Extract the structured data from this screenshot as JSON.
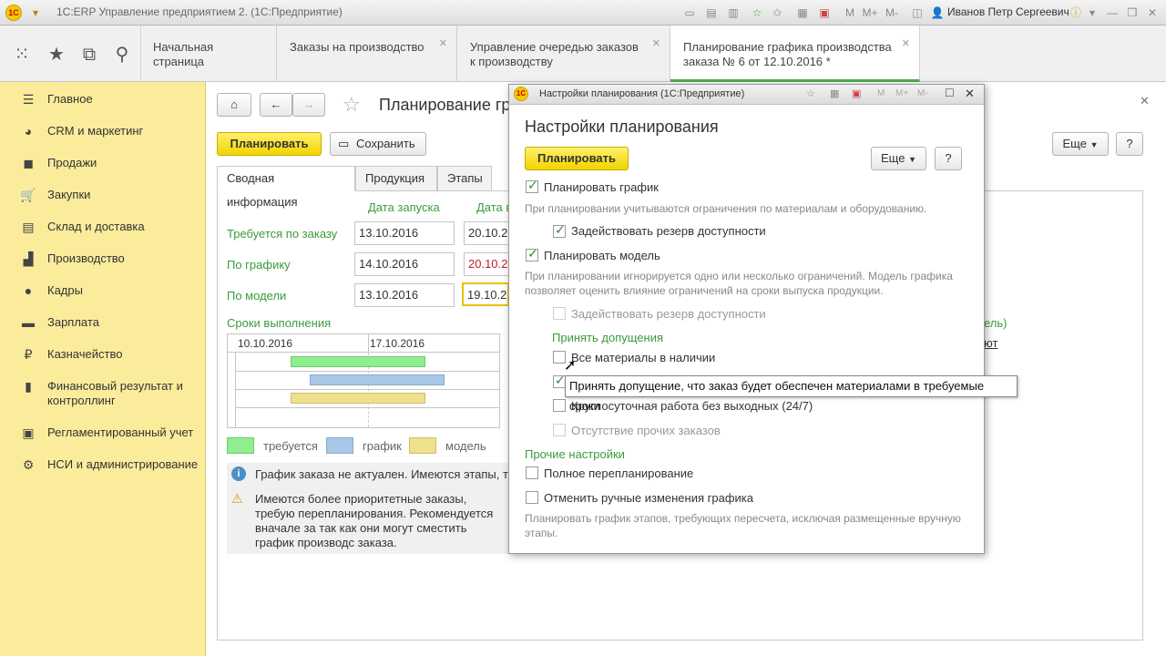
{
  "window": {
    "title": "1С:ERP Управление предприятием 2. (1С:Предприятие)",
    "user": "Иванов Петр Сергеевич",
    "logo_text": "1С"
  },
  "topbar": {
    "tabs": [
      {
        "label": "Начальная страница",
        "closable": false
      },
      {
        "label": "Заказы на производство",
        "closable": true
      },
      {
        "label": "Управление очередью заказов к производству",
        "closable": true
      },
      {
        "label": "Планирование графика производства заказа № 6 от 12.10.2016 *",
        "closable": true,
        "active": true
      }
    ]
  },
  "sidebar": {
    "items": [
      {
        "label": "Главное",
        "icon": "menu-icon"
      },
      {
        "label": "CRM и маркетинг",
        "icon": "pie-chart-icon"
      },
      {
        "label": "Продажи",
        "icon": "bag-icon"
      },
      {
        "label": "Закупки",
        "icon": "cart-icon"
      },
      {
        "label": "Склад и доставка",
        "icon": "warehouse-icon"
      },
      {
        "label": "Производство",
        "icon": "factory-icon"
      },
      {
        "label": "Кадры",
        "icon": "person-icon"
      },
      {
        "label": "Зарплата",
        "icon": "list-icon"
      },
      {
        "label": "Казначейство",
        "icon": "ruble-icon"
      },
      {
        "label": "Финансовый результат и контроллинг",
        "icon": "bar-chart-icon"
      },
      {
        "label": "Регламентированный учет",
        "icon": "document-icon"
      },
      {
        "label": "НСИ и администрирование",
        "icon": "gear-icon"
      }
    ]
  },
  "main": {
    "title": "Планирование гр",
    "plan_button": "Планировать",
    "save_button": "Сохранить",
    "more_button": "Еще",
    "help_button": "?",
    "tabs": [
      "Сводная информация",
      "Продукция",
      "Этапы"
    ],
    "col_start": "Дата запуска",
    "col_release": "Дата в",
    "rows": [
      {
        "label": "Требуется по заказу",
        "start": "13.10.2016",
        "release": "20.10.20"
      },
      {
        "label": "По графику",
        "start": "14.10.2016",
        "release": "20.10.20"
      },
      {
        "label": "По модели",
        "start": "13.10.2016",
        "release": "19.10.20"
      }
    ],
    "gantt_title": "Сроки выполнения",
    "gantt_dates": [
      "10.10.2016",
      "17.10.2016"
    ],
    "legend": [
      {
        "label": "требуется",
        "color": "#90ee90"
      },
      {
        "label": "график",
        "color": "#a8c8e8"
      },
      {
        "label": "модель",
        "color": "#eee08c"
      }
    ],
    "info_message": "График заказа не актуален. Имеются этапы, тр",
    "warning_message": "Имеются более приоритетные заказы, требую перепланирования. Рекомендуется вначале за так как они могут сместить график производс заказа.",
    "right_fragment_1": "ель)",
    "right_fragment_2": "ют"
  },
  "dialog": {
    "window_title": "Настройки планирования (1С:Предприятие)",
    "heading": "Настройки планирования",
    "plan_button": "Планировать",
    "more_button": "Еще",
    "help_button": "?",
    "plan_schedule": {
      "label": "Планировать график",
      "checked": true
    },
    "plan_schedule_hint": "При планировании учитываются ограничения по материалам и оборудованию.",
    "use_reserve_1": {
      "label": "Задействовать резерв доступности",
      "checked": true
    },
    "plan_model": {
      "label": "Планировать модель",
      "checked": true
    },
    "plan_model_hint": "При планировании игнорируется одно или несколько ограничений. Модель графика позволяет оценить влияние ограничений на сроки выпуска продукции.",
    "use_reserve_2": {
      "label": "Задействовать резерв доступности",
      "checked": false
    },
    "assumptions_title": "Принять допущения",
    "all_materials": {
      "label": "Все материалы в наличии",
      "checked": false
    },
    "materials_assumption_checked": true,
    "round_clock": {
      "label": "Круглосуточная работа без выходных (24/7)",
      "checked": false
    },
    "no_other_orders": {
      "label": "Отсутствие прочих заказов",
      "checked": false
    },
    "other_settings_title": "Прочие настройки",
    "full_replan": {
      "label": "Полное перепланирование",
      "checked": false
    },
    "cancel_manual": {
      "label": "Отменить ручные изменения графика",
      "checked": false
    },
    "bottom_hint": "Планировать график этапов, требующих пересчета, исключая размещенные вручную этапы."
  },
  "tooltip": {
    "text": "Принять допущение, что заказ будет обеспечен материалами в требуемые сроки"
  },
  "colors": {
    "accent_green": "#3c9a3c",
    "sidebar_bg": "#fbec9c",
    "button_yellow": "#f2d400"
  }
}
